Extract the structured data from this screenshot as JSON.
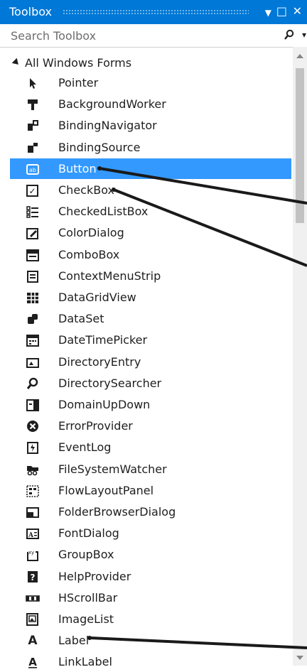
{
  "window": {
    "title": "Toolbox",
    "menu_glyph": "▼",
    "restore_glyph": "□",
    "close_glyph": "✕"
  },
  "search": {
    "placeholder": "Search Toolbox",
    "icon": "search-icon",
    "dropdown_glyph": "▾"
  },
  "group": {
    "label": "All Windows Forms",
    "expanded": true
  },
  "items": [
    {
      "label": "Pointer",
      "icon": "pointer-icon"
    },
    {
      "label": "BackgroundWorker",
      "icon": "backgroundworker-icon"
    },
    {
      "label": "BindingNavigator",
      "icon": "bindingnavigator-icon"
    },
    {
      "label": "BindingSource",
      "icon": "bindingsource-icon"
    },
    {
      "label": "Button",
      "icon": "button-icon",
      "selected": true,
      "glyph": "ab"
    },
    {
      "label": "CheckBox",
      "icon": "checkbox-icon",
      "glyph": "✓"
    },
    {
      "label": "CheckedListBox",
      "icon": "checkedlistbox-icon"
    },
    {
      "label": "ColorDialog",
      "icon": "colordialog-icon"
    },
    {
      "label": "ComboBox",
      "icon": "combobox-icon"
    },
    {
      "label": "ContextMenuStrip",
      "icon": "contextmenustrip-icon"
    },
    {
      "label": "DataGridView",
      "icon": "datagridview-icon"
    },
    {
      "label": "DataSet",
      "icon": "dataset-icon"
    },
    {
      "label": "DateTimePicker",
      "icon": "datetimepicker-icon"
    },
    {
      "label": "DirectoryEntry",
      "icon": "directoryentry-icon"
    },
    {
      "label": "DirectorySearcher",
      "icon": "directorysearcher-icon"
    },
    {
      "label": "DomainUpDown",
      "icon": "domainupdown-icon"
    },
    {
      "label": "ErrorProvider",
      "icon": "errorprovider-icon"
    },
    {
      "label": "EventLog",
      "icon": "eventlog-icon"
    },
    {
      "label": "FileSystemWatcher",
      "icon": "filesystemwatcher-icon"
    },
    {
      "label": "FlowLayoutPanel",
      "icon": "flowlayoutpanel-icon"
    },
    {
      "label": "FolderBrowserDialog",
      "icon": "folderbrowserdialog-icon"
    },
    {
      "label": "FontDialog",
      "icon": "fontdialog-icon"
    },
    {
      "label": "GroupBox",
      "icon": "groupbox-icon",
      "glyph": "xy"
    },
    {
      "label": "HelpProvider",
      "icon": "helpprovider-icon",
      "glyph": "?"
    },
    {
      "label": "HScrollBar",
      "icon": "hscrollbar-icon"
    },
    {
      "label": "ImageList",
      "icon": "imagelist-icon"
    },
    {
      "label": "Label",
      "icon": "label-icon",
      "glyph": "A"
    },
    {
      "label": "LinkLabel",
      "icon": "linklabel-icon",
      "glyph": "A"
    }
  ],
  "colors": {
    "accent": "#0078d7",
    "selection": "#3399ff",
    "icon": "#1e1e1e",
    "annotation_line": "#1a1a1a"
  }
}
